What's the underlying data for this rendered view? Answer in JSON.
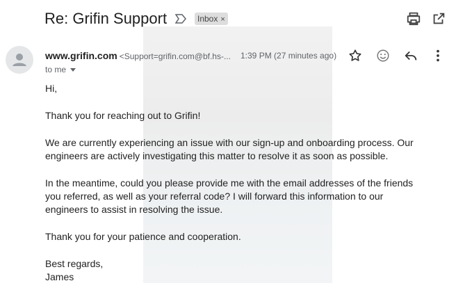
{
  "email": {
    "subject": "Re: Grifin Support",
    "label": "Inbox",
    "label_close": "×",
    "sender_name": "www.grifin.com",
    "sender_email": "<Support=grifin.com@bf.hs-...",
    "time": "1:39 PM (27 minutes ago)",
    "recipient": "to me",
    "body": {
      "greeting": "Hi,",
      "thanks": "Thank you for reaching out to Grifin!",
      "para1_line1": "We are currently experiencing an issue with our sign-up and onboarding process. Our",
      "para1_line2": "engineers are actively investigating this matter to resolve it as soon as possible.",
      "para2_line1": "In the meantime, could you please provide me with the email addresses of the friends",
      "para2_line2": "you referred, as well as your referral code? I will forward this information to our",
      "para2_line3": "engineers to assist in resolving the issue.",
      "closing_thanks": "Thank you for your patience and cooperation.",
      "signoff": "Best regards,",
      "signature": "James"
    }
  },
  "icons": {
    "important": "important-marker-icon",
    "print": "print-icon",
    "open_new": "open-in-new-window-icon",
    "avatar": "person-icon",
    "star": "star-icon",
    "emoji": "emoji-reaction-icon",
    "reply": "reply-icon",
    "more": "more-vert-icon",
    "dropdown": "chevron-down-icon"
  }
}
